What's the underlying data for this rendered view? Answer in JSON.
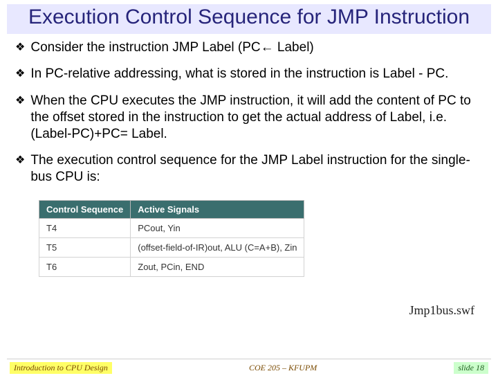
{
  "title": "Execution Control Sequence for JMP Instruction",
  "bullets": [
    "Consider the instruction JMP Label (PC← Label)",
    "In PC-relative addressing, what is stored in the instruction is Label - PC.",
    "When the CPU executes the JMP instruction, it will add the content of PC to the offset stored in the instruction to get the actual address of Label, i.e. (Label-PC)+PC= Label.",
    "The execution control sequence for the JMP Label instruction for the single-bus CPU is:"
  ],
  "table": {
    "headers": [
      "Control Sequence",
      "Active Signals"
    ],
    "rows": [
      [
        "T4",
        "PCout, Yin"
      ],
      [
        "T5",
        "(offset-field-of-IR)out, ALU (C=A+B), Zin"
      ],
      [
        "T6",
        "Zout, PCin, END"
      ]
    ]
  },
  "swf_label": "Jmp1bus.swf",
  "footer": {
    "left": "Introduction to CPU Design",
    "mid": "COE 205 – KFUPM",
    "right": "slide 18"
  }
}
